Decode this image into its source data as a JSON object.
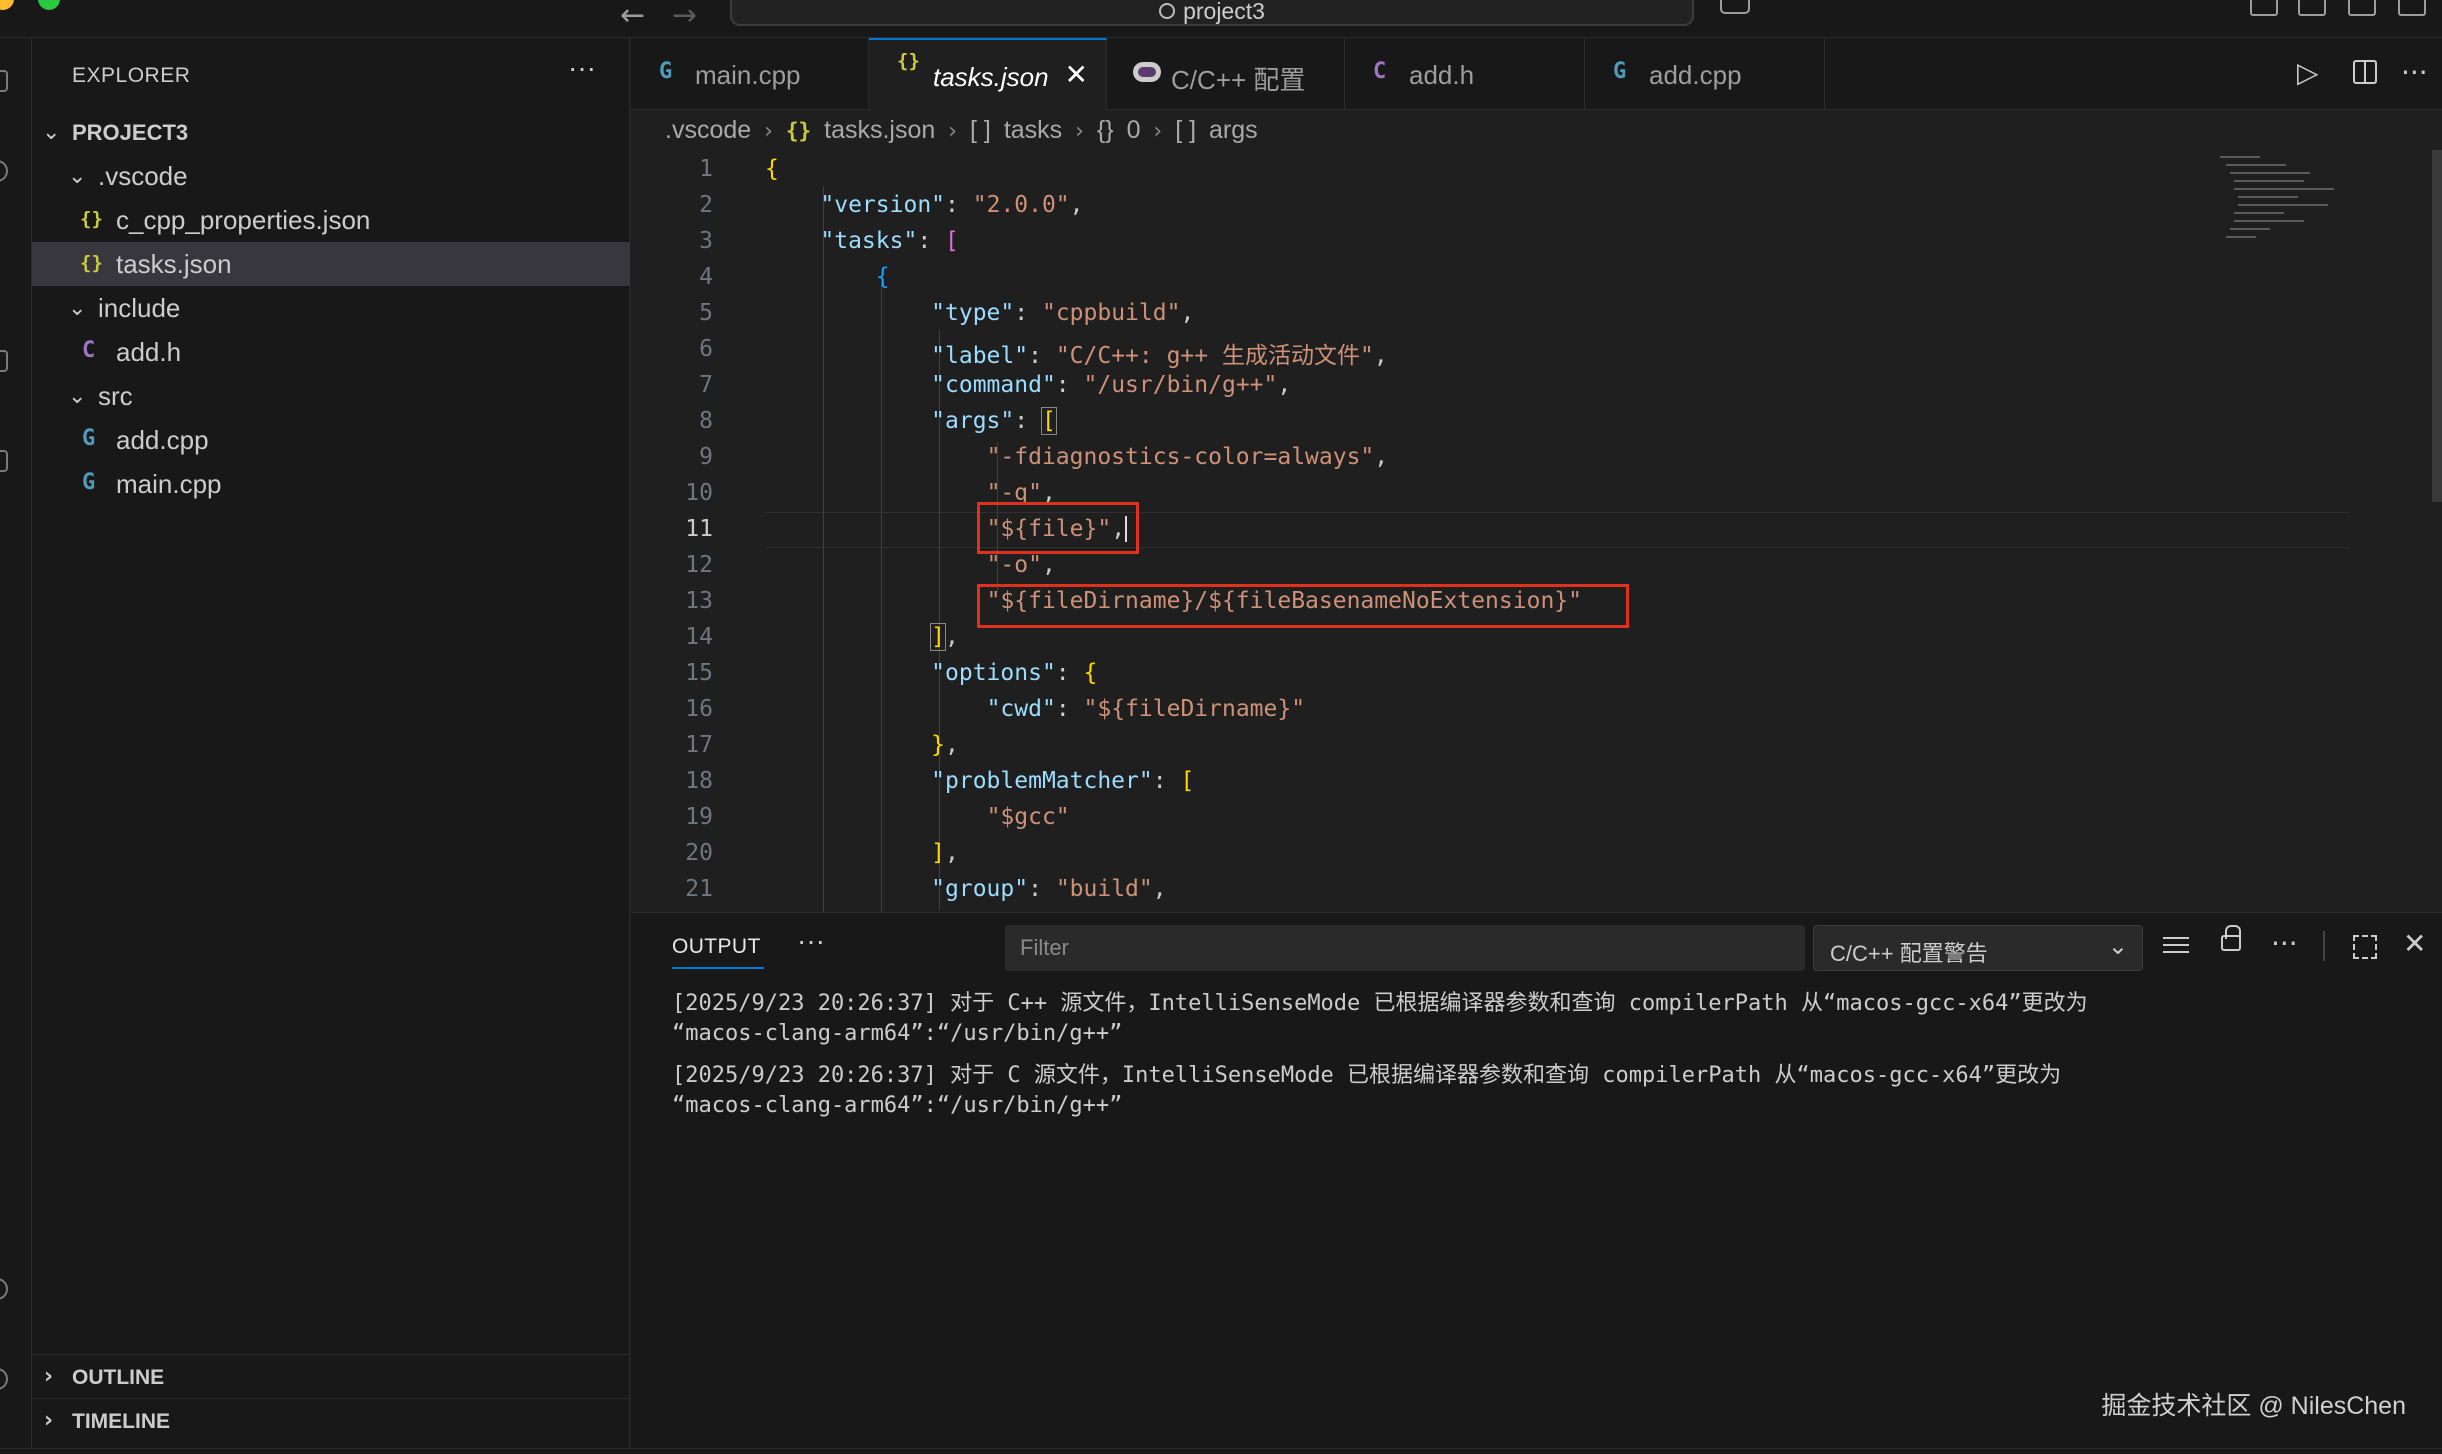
{
  "titlebar": {
    "project_name": "project3",
    "back_arrow": "←",
    "forward_arrow": "→"
  },
  "sidebar": {
    "header": "EXPLORER",
    "more": "···",
    "tree": [
      {
        "label": "PROJECT3",
        "kind": "folder-root",
        "expanded": true
      },
      {
        "label": ".vscode",
        "kind": "folder",
        "expanded": true
      },
      {
        "label": "c_cpp_properties.json",
        "kind": "json",
        "icon": "{}"
      },
      {
        "label": "tasks.json",
        "kind": "json",
        "icon": "{}",
        "selected": true
      },
      {
        "label": "include",
        "kind": "folder",
        "expanded": true
      },
      {
        "label": "add.h",
        "kind": "c",
        "icon": "C"
      },
      {
        "label": "src",
        "kind": "folder",
        "expanded": true
      },
      {
        "label": "add.cpp",
        "kind": "cpp",
        "icon": "G"
      },
      {
        "label": "main.cpp",
        "kind": "cpp",
        "icon": "G"
      }
    ],
    "sections": {
      "outline": "OUTLINE",
      "timeline": "TIMELINE"
    }
  },
  "tabs": [
    {
      "label": "main.cpp",
      "icon": "G",
      "active": false
    },
    {
      "label": "tasks.json",
      "icon": "{}",
      "active": true,
      "close": "✕"
    },
    {
      "label": "C/C++ 配置",
      "icon": "gear-badge",
      "active": false
    },
    {
      "label": "add.h",
      "icon": "C",
      "active": false
    },
    {
      "label": "add.cpp",
      "icon": "G",
      "active": false
    }
  ],
  "tab_actions": {
    "run": "▷",
    "more": "···"
  },
  "breadcrumb": {
    "folder": ".vscode",
    "file_icon": "{}",
    "file": "tasks.json",
    "tasks_icon": "[ ]",
    "tasks": "tasks",
    "obj_icon": "{}",
    "obj": "0",
    "args_icon": "[ ]",
    "args": "args",
    "sep": "›"
  },
  "editor": {
    "current_line": "11",
    "lines": [
      {
        "n": "1"
      },
      {
        "n": "2"
      },
      {
        "n": "3"
      },
      {
        "n": "4"
      },
      {
        "n": "5"
      },
      {
        "n": "6"
      },
      {
        "n": "7"
      },
      {
        "n": "8"
      },
      {
        "n": "9"
      },
      {
        "n": "10"
      },
      {
        "n": "11"
      },
      {
        "n": "12"
      },
      {
        "n": "13"
      },
      {
        "n": "14"
      },
      {
        "n": "15"
      },
      {
        "n": "16"
      },
      {
        "n": "17"
      },
      {
        "n": "18"
      },
      {
        "n": "19"
      },
      {
        "n": "20"
      },
      {
        "n": "21"
      }
    ],
    "tokens": {
      "version_key": "\"version\"",
      "version_val": "\"2.0.0\"",
      "tasks_key": "\"tasks\"",
      "type_key": "\"type\"",
      "type_val": "\"cppbuild\"",
      "label_key": "\"label\"",
      "label_val": "\"C/C++: g++ 生成活动文件\"",
      "command_key": "\"command\"",
      "command_val": "\"/usr/bin/g++\"",
      "args_key": "\"args\"",
      "arg1": "\"-fdiagnostics-color=always\"",
      "arg2": "\"-g\"",
      "arg3": "\"${file}\"",
      "arg4": "\"-o\"",
      "arg5": "\"${fileDirname}/${fileBasenameNoExtension}\"",
      "options_key": "\"options\"",
      "cwd_key": "\"cwd\"",
      "cwd_val": "\"${fileDirname}\"",
      "pm_key": "\"problemMatcher\"",
      "pm_val": "\"$gcc\"",
      "group_key": "\"group\"",
      "group_val": "\"build\""
    }
  },
  "panel": {
    "tab": "OUTPUT",
    "more": "···",
    "filter_placeholder": "Filter",
    "channel": "C/C++ 配置警告",
    "output_lines": [
      "[2025/9/23 20:26:37] 对于 C++ 源文件，IntelliSenseMode 已根据编译器参数和查询 compilerPath 从“macos-gcc-x64”更改为",
      "“macos-clang-arm64”:“/usr/bin/g++”",
      "[2025/9/23 20:26:37] 对于 C 源文件，IntelliSenseMode 已根据编译器参数和查询 compilerPath 从“macos-gcc-x64”更改为",
      "“macos-clang-arm64”:“/usr/bin/g++”"
    ]
  },
  "watermark": "掘金技术社区 @ NilesChen",
  "colors": {
    "accent": "#0078d4",
    "highlight_box": "#e0311f",
    "json_key": "#9cdcfe",
    "json_string": "#ce9178"
  }
}
